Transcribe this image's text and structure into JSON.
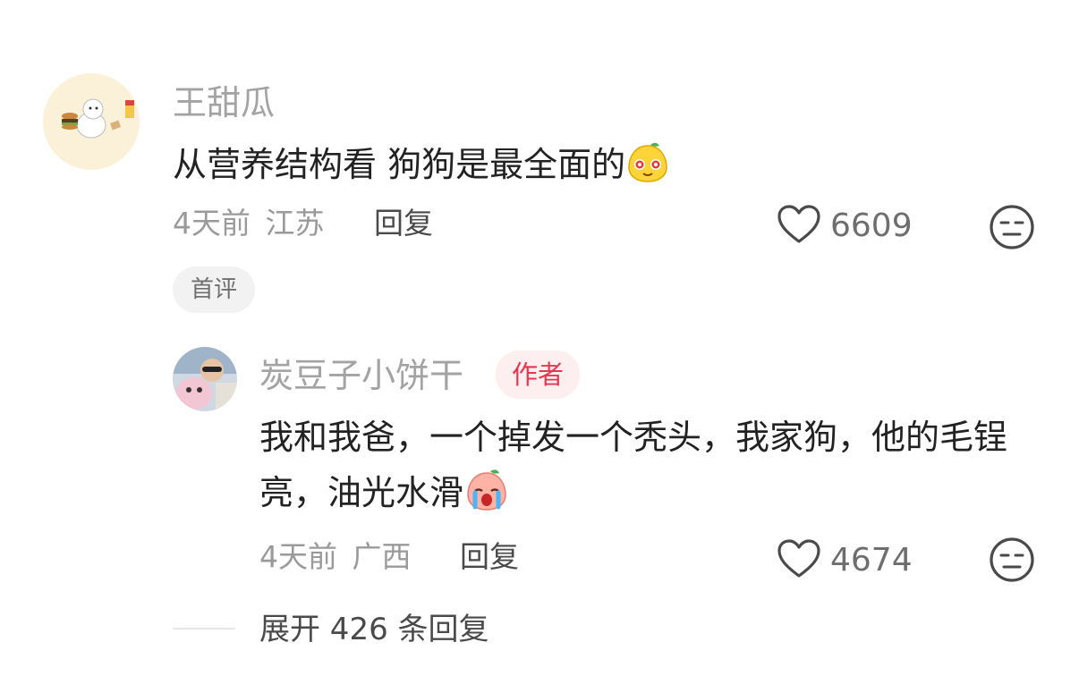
{
  "comment": {
    "username": "王甜瓜",
    "text": "从营养结构看 狗狗是最全面的",
    "time": "4天前",
    "location": "江苏",
    "reply_label": "回复",
    "like_count": "6609",
    "badge": "首评"
  },
  "reply": {
    "username": "炭豆子小饼干",
    "author_badge": "作者",
    "text": "我和我爸，一个掉发一个秃头，我家狗，他的毛锃亮，油光水滑",
    "time": "4天前",
    "location": "广西",
    "reply_label": "回复",
    "like_count": "4674"
  },
  "expand_label": "展开 426 条回复",
  "colors": {
    "author_badge_text": "#e8364f",
    "author_badge_bg": "#fdeef0",
    "username": "#a3a3a3"
  }
}
